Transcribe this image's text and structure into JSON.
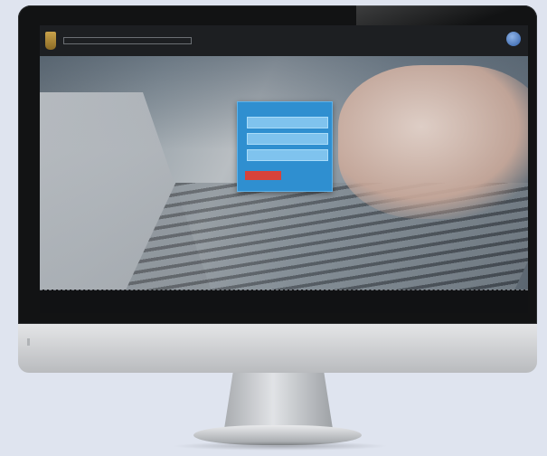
{
  "device": {
    "brand_icon": "gold-emblem-icon",
    "globe_icon": "globe-icon"
  },
  "site": {
    "title": "",
    "login": {
      "title": "",
      "username_placeholder": "",
      "password_placeholder": "",
      "button_label": "",
      "forgot_link": ""
    },
    "below_card_text": "",
    "footer_text": ""
  },
  "colors": {
    "login_card": "#2f8fd0",
    "login_button": "#d7433a",
    "header": "#1d1f22"
  }
}
